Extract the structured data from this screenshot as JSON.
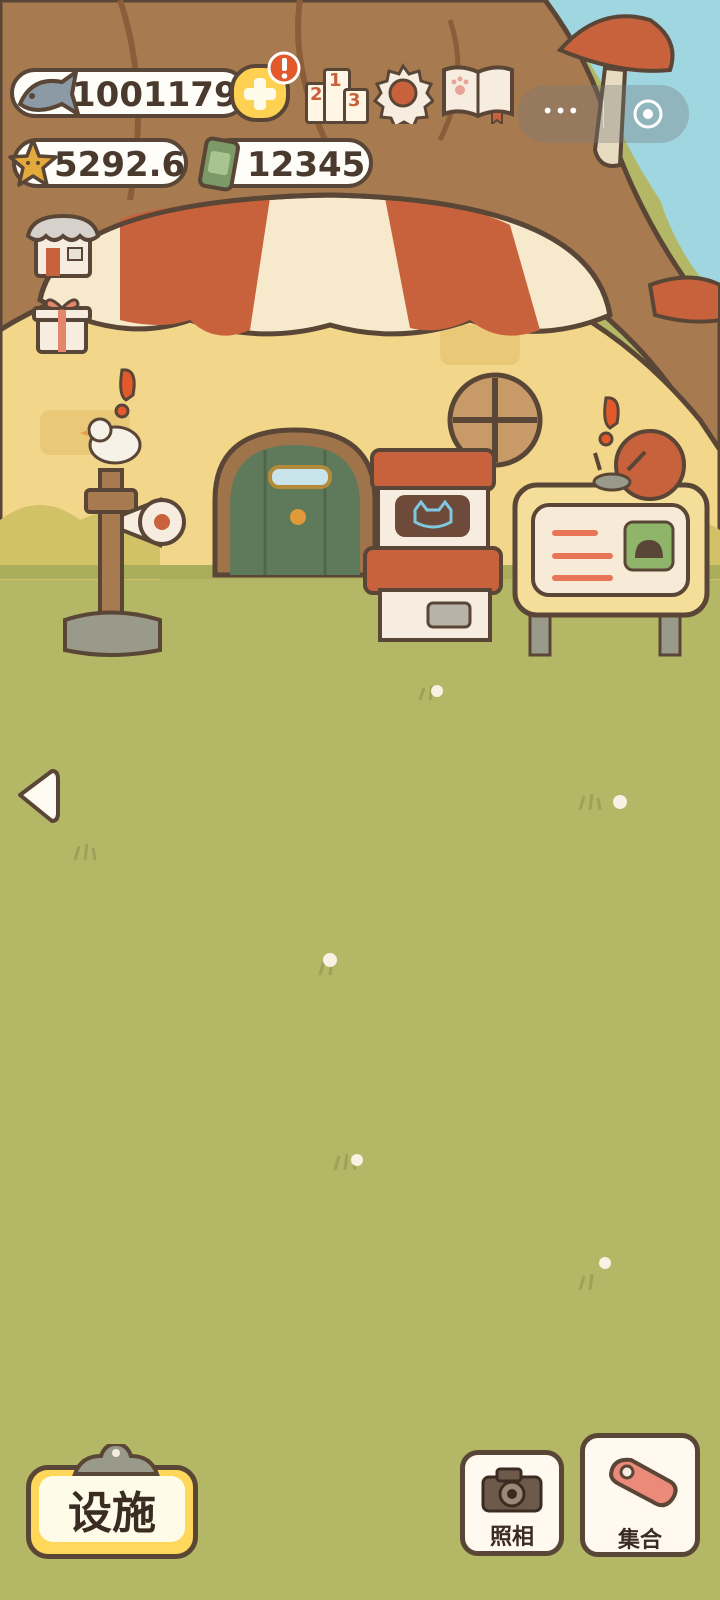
{
  "resources": {
    "fish": "1001179",
    "stars": "5292.6",
    "cans": "12345"
  },
  "buttons": {
    "facility_label": "设施",
    "photo_label": "照相",
    "gather_label": "集合"
  },
  "ranking_icon": {
    "digit_left": "2",
    "digit_center": "1",
    "digit_right": "3"
  },
  "capsule": {
    "menu_glyph": "•••"
  },
  "colors": {
    "grass": "#b3b766",
    "awning_red": "#c8623c",
    "awning_cream": "#f6e9cc",
    "house_wall": "#f2d68a",
    "outline": "#5a4636",
    "sky": "#9fd6e0",
    "accent_orange": "#e25a2c"
  }
}
